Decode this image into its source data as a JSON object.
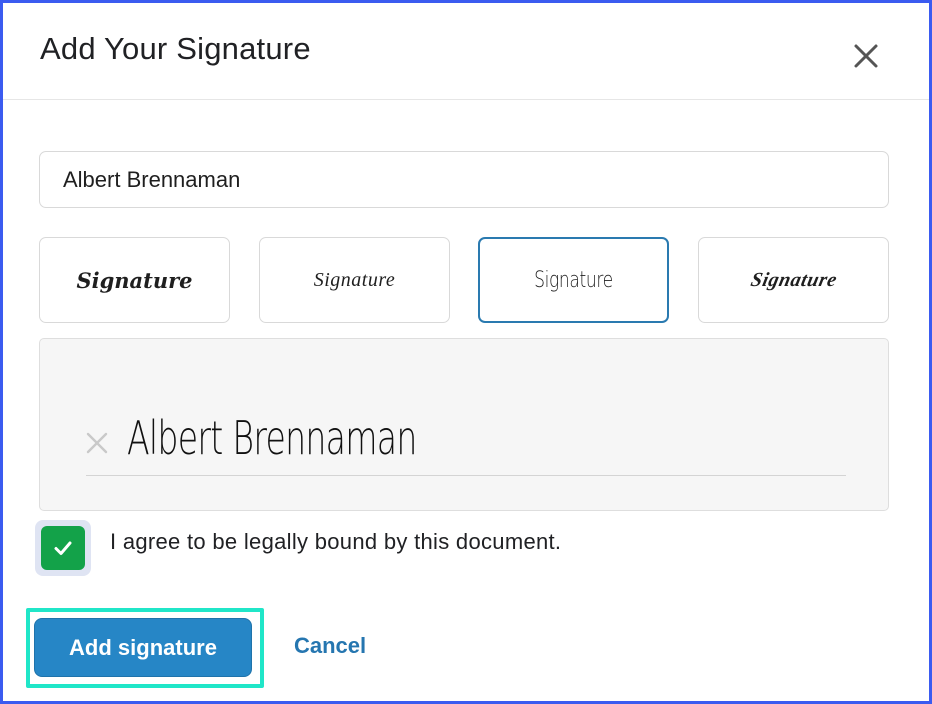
{
  "dialog": {
    "title": "Add Your Signature",
    "close_icon": "close-icon"
  },
  "name_field": {
    "value": "Albert Brennaman"
  },
  "style_options": [
    {
      "label": "Signature",
      "selected": false
    },
    {
      "label": "Signature",
      "selected": false
    },
    {
      "label": "Signature",
      "selected": true
    },
    {
      "label": "Signature",
      "selected": false
    }
  ],
  "signature_pad": {
    "signature_text": "Albert Brennaman",
    "clear_icon": "clear-x-icon"
  },
  "agreement": {
    "checked": true,
    "label": "I agree to be legally bound by this document."
  },
  "actions": {
    "primary_label": "Add signature",
    "cancel_label": "Cancel"
  },
  "colors": {
    "primary": "#2686c6",
    "checkbox": "#13a249",
    "selected_border": "#2a7ab0",
    "focus_ring": "#20e6c8",
    "cancel_text": "#2576b0"
  }
}
